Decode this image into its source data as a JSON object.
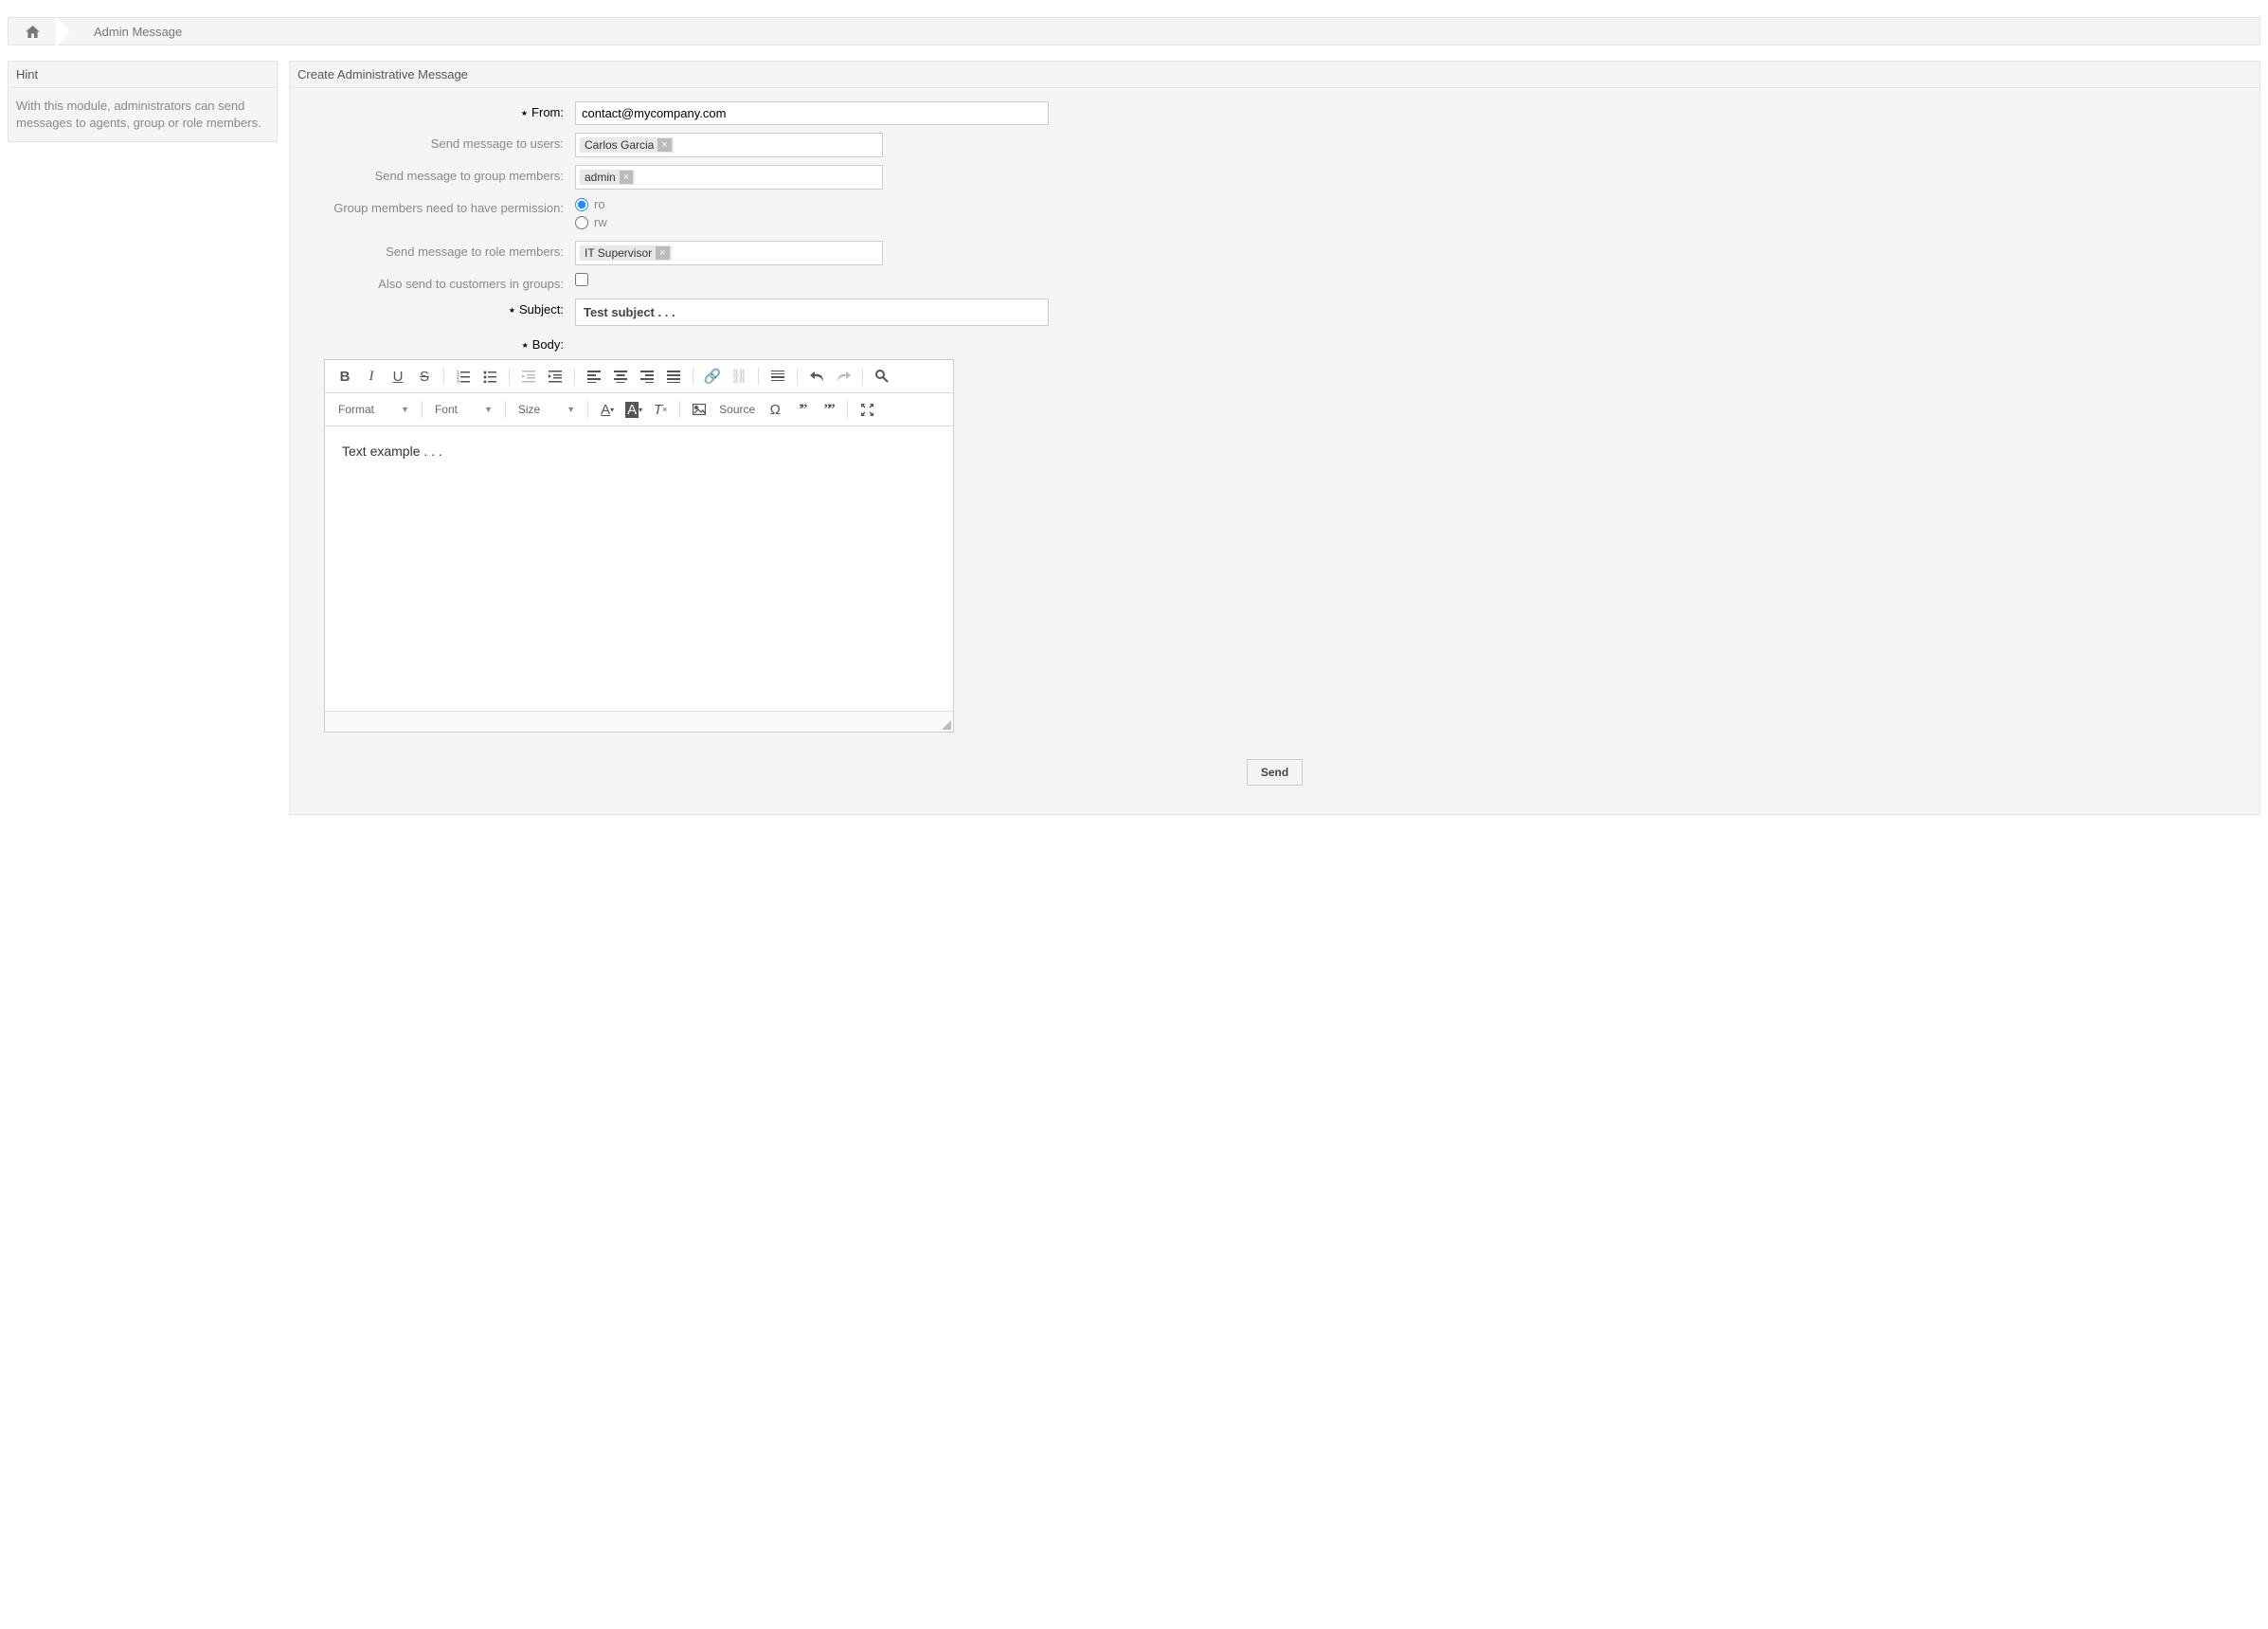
{
  "breadcrumb": {
    "title": "Admin Message"
  },
  "sidebar": {
    "hint_title": "Hint",
    "hint_text": "With this module, administrators can send messages to agents, group or role members."
  },
  "panel": {
    "title": "Create Administrative Message"
  },
  "form": {
    "from_label": "From:",
    "from_value": "contact@mycompany.com",
    "users_label": "Send message to users:",
    "users_tags": [
      "Carlos Garcia"
    ],
    "groups_label": "Send message to group members:",
    "group_tags": [
      "admin"
    ],
    "perm_label": "Group members need to have permission:",
    "perm_options": {
      "ro": "ro",
      "rw": "rw"
    },
    "perm_selected": "ro",
    "roles_label": "Send message to role members:",
    "role_tags": [
      "IT Supervisor"
    ],
    "customers_label": "Also send to customers in groups:",
    "subject_label": "Subject:",
    "subject_value": "Test subject . . .",
    "body_label": "Body:"
  },
  "editor": {
    "format": "Format",
    "font": "Font",
    "size": "Size",
    "source": "Source",
    "body_text": "Text example . . ."
  },
  "actions": {
    "send": "Send"
  }
}
